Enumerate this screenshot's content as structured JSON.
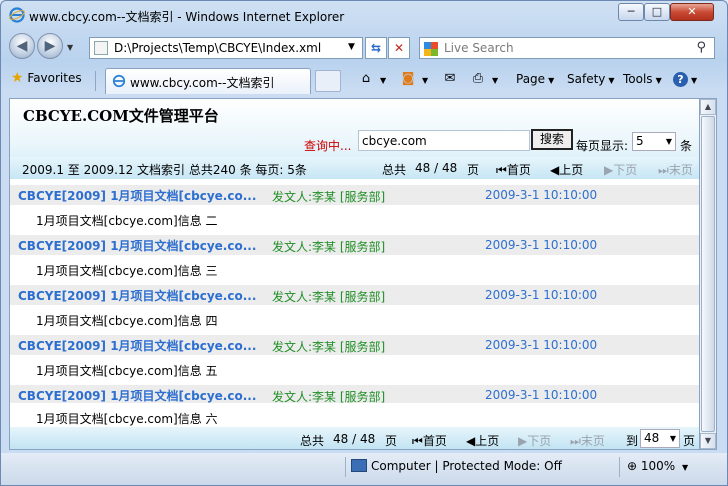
{
  "window": {
    "title": "www.cbcy.com--文档索引 - Windows Internet Explorer",
    "min_label": "─",
    "max_label": "□",
    "close_label": "✕"
  },
  "address": {
    "url": "D:\\Projects\\Temp\\CBCYE\\Index.xml",
    "search_placeholder": "Live Search"
  },
  "commandbar": {
    "favorites": "Favorites",
    "tab_title": "www.cbcy.com--文档索引",
    "page": "Page",
    "safety": "Safety",
    "tools": "Tools",
    "help": "?"
  },
  "page": {
    "site_title": "CBCYE.COM文件管理平台",
    "search_label": "查询中...",
    "query_value": "cbcye.com",
    "search_button": "搜索",
    "per_page_label": "每页显示:",
    "per_page_value": "5",
    "per_page_unit": "条",
    "info": "2009.1 至  2009.12 文档索引  总共240 条  每页: 5条",
    "pager": {
      "total_label": "总共",
      "page_status": "48 / 48",
      "page_unit": "页",
      "first": "首页",
      "prev": "上页",
      "next": "下页",
      "last": "末页",
      "goto_label": "到",
      "goto_value": "48",
      "goto_unit": "页"
    },
    "results": [
      {
        "title": "CBCYE[2009] 1月项目文档[cbcye.co...",
        "author": "发文人:李某 [服务部]",
        "date": "2009-3-1 10:10:00",
        "desc": "1月项目文档[cbcye.com]信息   二"
      },
      {
        "title": "CBCYE[2009] 1月项目文档[cbcye.co...",
        "author": "发文人:李某 [服务部]",
        "date": "2009-3-1 10:10:00",
        "desc": "1月项目文档[cbcye.com]信息   三"
      },
      {
        "title": "CBCYE[2009] 1月项目文档[cbcye.co...",
        "author": "发文人:李某 [服务部]",
        "date": "2009-3-1 10:10:00",
        "desc": "1月项目文档[cbcye.com]信息   四"
      },
      {
        "title": "CBCYE[2009] 1月项目文档[cbcye.co...",
        "author": "发文人:李某 [服务部]",
        "date": "2009-3-1 10:10:00",
        "desc": "1月项目文档[cbcye.com]信息   五"
      },
      {
        "title": "CBCYE[2009] 1月项目文档[cbcye.co...",
        "author": "发文人:李某 [服务部]",
        "date": "2009-3-1 10:10:00",
        "desc": "1月项目文档[cbcye.com]信息   六"
      }
    ]
  },
  "status": {
    "zone": "Computer | Protected Mode: Off",
    "zoom": "100%"
  }
}
